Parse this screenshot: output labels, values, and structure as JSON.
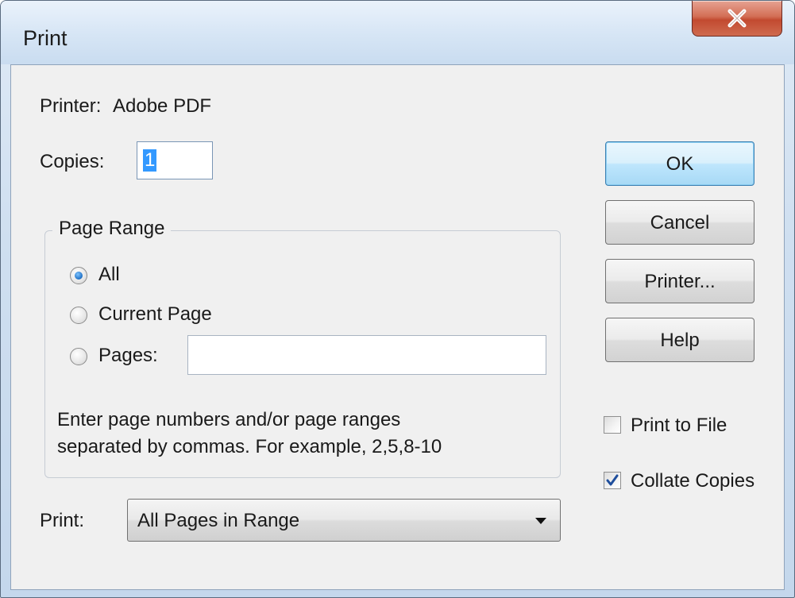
{
  "window": {
    "title": "Print",
    "close_symbol": "X"
  },
  "printer": {
    "label": "Printer:",
    "name": "Adobe PDF"
  },
  "copies": {
    "label": "Copies:",
    "value": "1"
  },
  "page_range": {
    "title": "Page Range",
    "options": [
      {
        "label": "All",
        "selected": true
      },
      {
        "label": "Current Page",
        "selected": false
      },
      {
        "label": "Pages:",
        "selected": false
      }
    ],
    "pages_value": "",
    "hint_line1": "Enter page numbers and/or page ranges",
    "hint_line2": "separated by commas. For example, 2,5,8-10"
  },
  "print_select": {
    "label": "Print:",
    "value": "All Pages in Range"
  },
  "buttons": {
    "ok": "OK",
    "cancel": "Cancel",
    "printer": "Printer...",
    "help": "Help"
  },
  "options": {
    "print_to_file": {
      "label": "Print to File",
      "checked": false
    },
    "collate_copies": {
      "label": "Collate Copies",
      "checked": true
    }
  },
  "colors": {
    "accent": "#3399ff",
    "close": "#c24a30",
    "default_button": "#bee6fd"
  }
}
